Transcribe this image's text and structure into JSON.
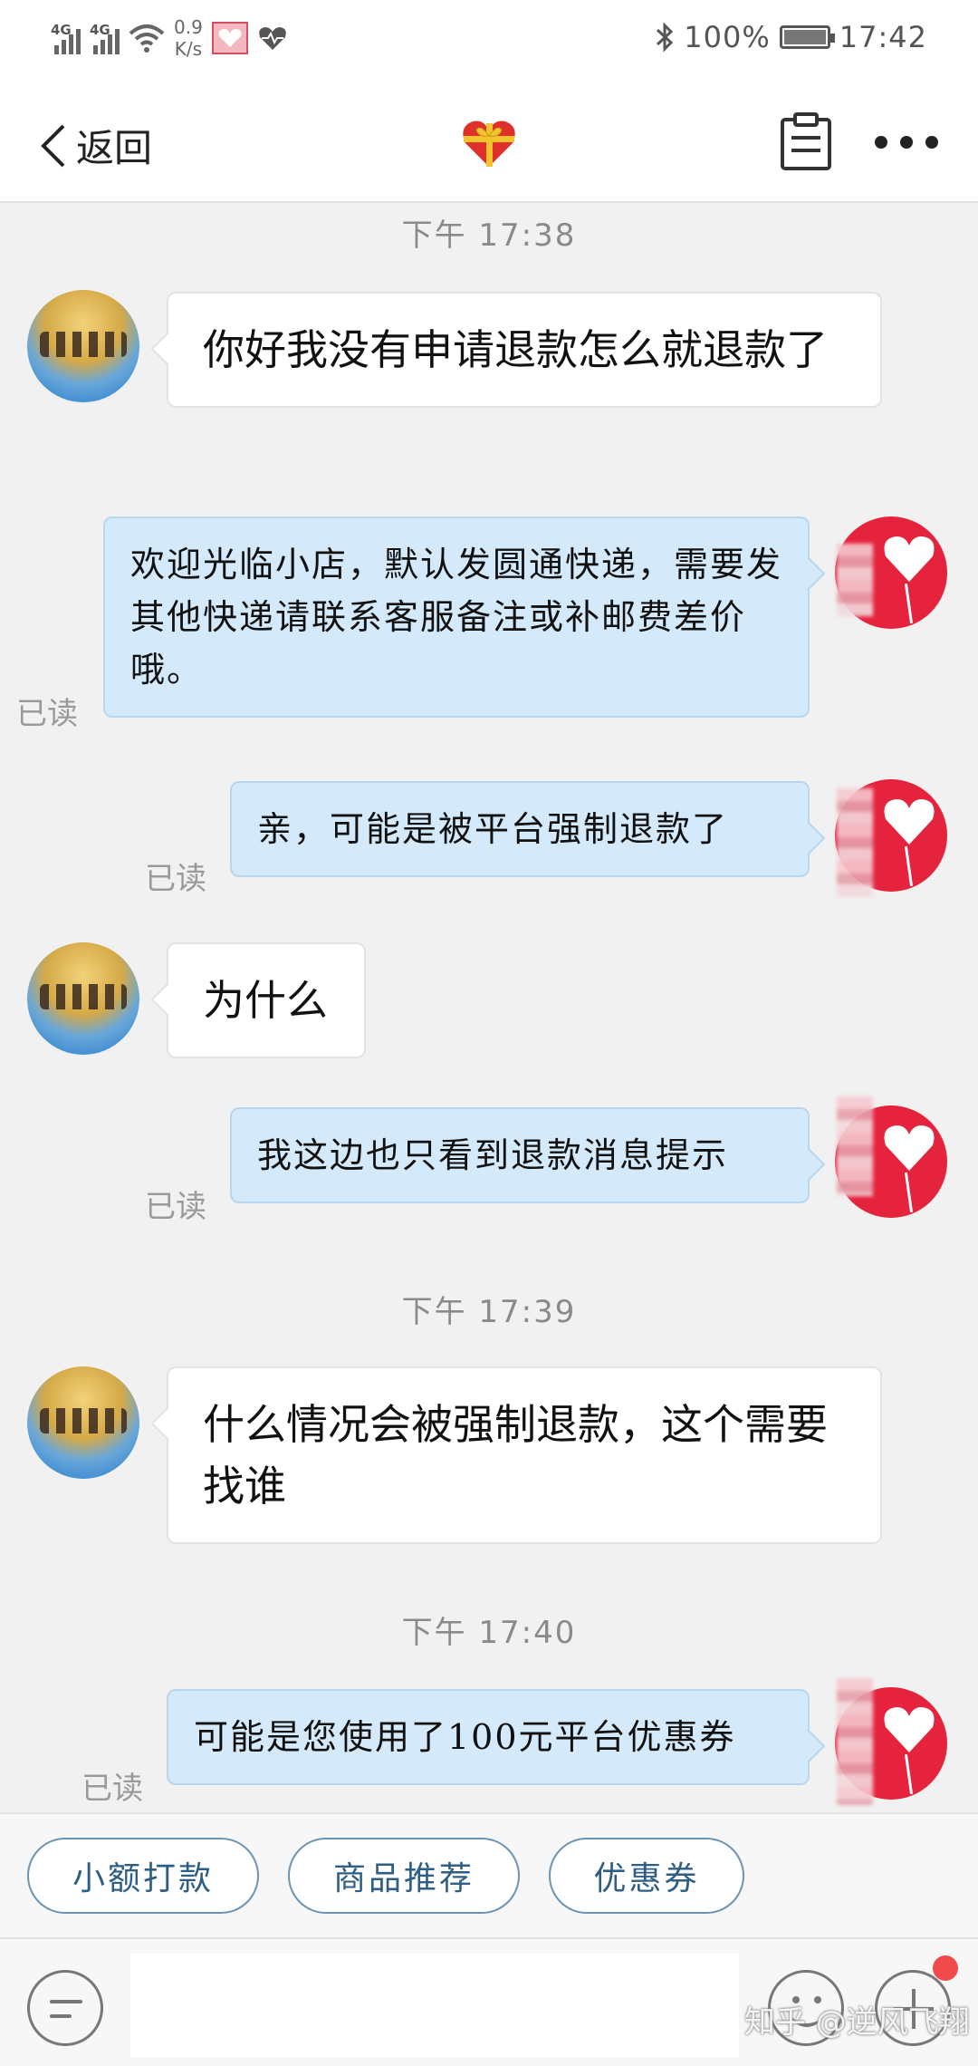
{
  "status_bar": {
    "signal1_tag": "4G",
    "signal2_tag": "4G",
    "speed_value": "0.9",
    "speed_unit": "K/s",
    "battery_percent": "100%",
    "clock": "17:42"
  },
  "nav": {
    "back_label": "返回"
  },
  "messages": [
    {
      "kind": "time",
      "text": "下午 17:38"
    },
    {
      "kind": "incoming",
      "text": "你好我没有申请退款怎么就退款了"
    },
    {
      "kind": "outgoing",
      "text": "欢迎光临小店，默认发圆通快递，需要发其他快递请联系客服备注或补邮费差价哦。",
      "status": "已读"
    },
    {
      "kind": "outgoing",
      "text": "亲，可能是被平台强制退款了",
      "status": "已读"
    },
    {
      "kind": "incoming",
      "text": "为什么"
    },
    {
      "kind": "outgoing",
      "text": "我这边也只看到退款消息提示",
      "status": "已读"
    },
    {
      "kind": "time",
      "text": "下午 17:39"
    },
    {
      "kind": "incoming",
      "text": "什么情况会被强制退款，这个需要找谁"
    },
    {
      "kind": "time",
      "text": "下午 17:40"
    },
    {
      "kind": "outgoing",
      "text": "可能是您使用了100元平台优惠券",
      "status": "已读"
    }
  ],
  "quick_actions": [
    "小额打款",
    "商品推荐",
    "优惠券"
  ],
  "input": {
    "placeholder": ""
  },
  "watermark": "知乎 @逆风飞翔",
  "colors": {
    "outgoing_bubble": "#d4e9f9",
    "incoming_bubble": "#ffffff",
    "quick_button_text": "#2e5e85",
    "avatar_red": "#e6233c",
    "notification_dot": "#f04a4a"
  }
}
